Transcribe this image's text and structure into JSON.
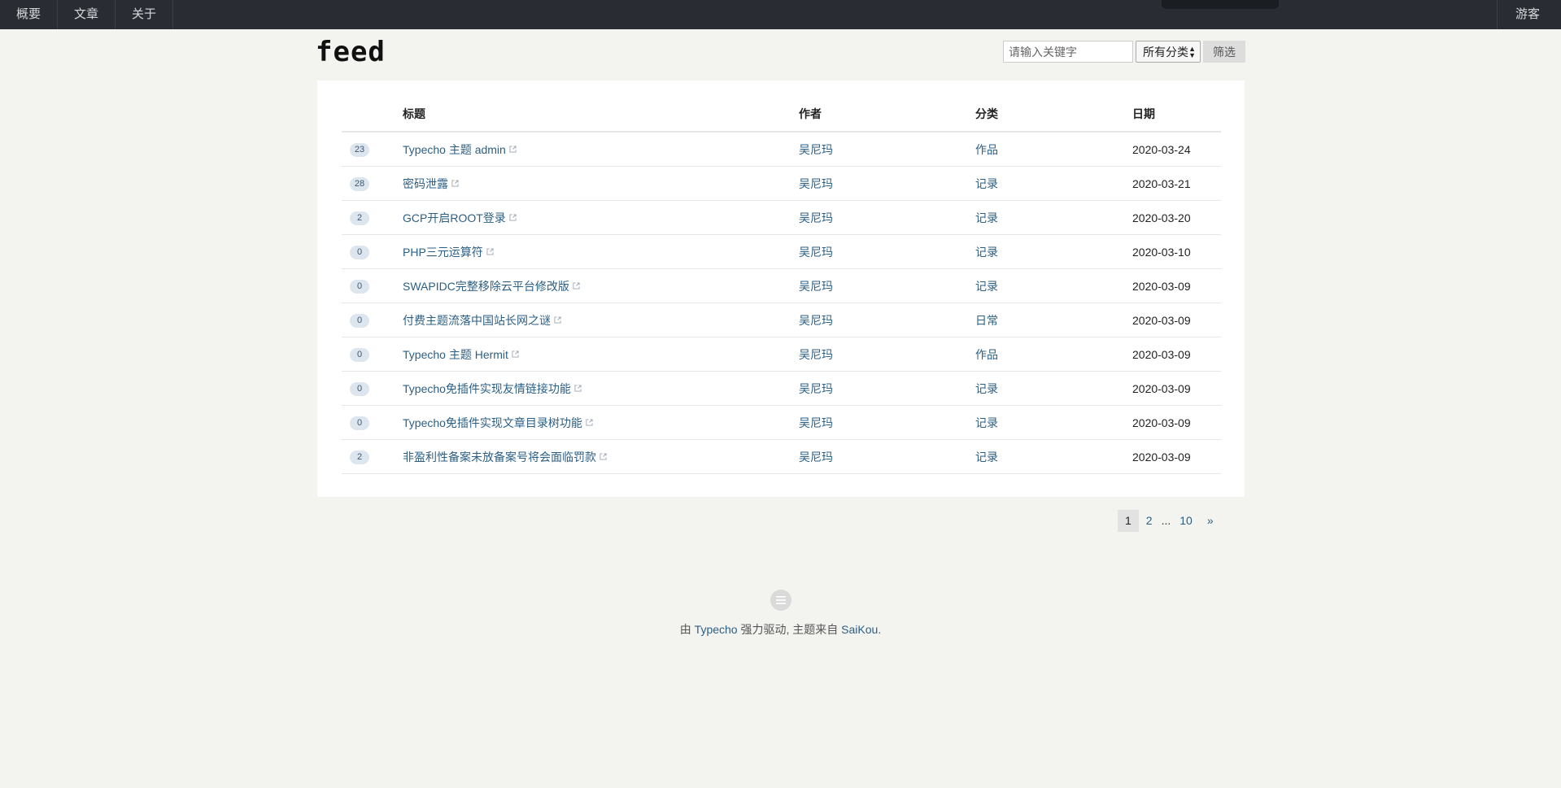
{
  "nav": {
    "items": [
      {
        "label": "概要"
      },
      {
        "label": "文章"
      },
      {
        "label": "关于"
      }
    ],
    "user_label": "游客"
  },
  "header": {
    "logo": "feed",
    "search_placeholder": "请输入关键字",
    "category_select": "所有分类",
    "filter_button": "筛选"
  },
  "table": {
    "headers": {
      "title": "标题",
      "author": "作者",
      "category": "分类",
      "date": "日期"
    },
    "rows": [
      {
        "count": "23",
        "title": "Typecho 主题 admin",
        "author": "吴尼玛",
        "category": "作品",
        "date": "2020-03-24"
      },
      {
        "count": "28",
        "title": "密码泄露",
        "author": "吴尼玛",
        "category": "记录",
        "date": "2020-03-21"
      },
      {
        "count": "2",
        "title": "GCP开启ROOT登录",
        "author": "吴尼玛",
        "category": "记录",
        "date": "2020-03-20"
      },
      {
        "count": "0",
        "title": "PHP三元运算符",
        "author": "吴尼玛",
        "category": "记录",
        "date": "2020-03-10"
      },
      {
        "count": "0",
        "title": "SWAPIDC完整移除云平台修改版",
        "author": "吴尼玛",
        "category": "记录",
        "date": "2020-03-09"
      },
      {
        "count": "0",
        "title": "付费主题流落中国站长网之谜",
        "author": "吴尼玛",
        "category": "日常",
        "date": "2020-03-09"
      },
      {
        "count": "0",
        "title": "Typecho 主题 Hermit",
        "author": "吴尼玛",
        "category": "作品",
        "date": "2020-03-09"
      },
      {
        "count": "0",
        "title": "Typecho免插件实现友情链接功能",
        "author": "吴尼玛",
        "category": "记录",
        "date": "2020-03-09"
      },
      {
        "count": "0",
        "title": "Typecho免插件实现文章目录树功能",
        "author": "吴尼玛",
        "category": "记录",
        "date": "2020-03-09"
      },
      {
        "count": "2",
        "title": "非盈利性备案未放备案号将会面临罚款",
        "author": "吴尼玛",
        "category": "记录",
        "date": "2020-03-09"
      }
    ]
  },
  "pagination": {
    "current": "1",
    "page2": "2",
    "dots": "...",
    "last": "10",
    "next": "»"
  },
  "footer": {
    "prefix": "由 ",
    "engine": "Typecho",
    "middle": " 强力驱动, 主题来自 ",
    "theme": "SaiKou",
    "suffix": "."
  }
}
